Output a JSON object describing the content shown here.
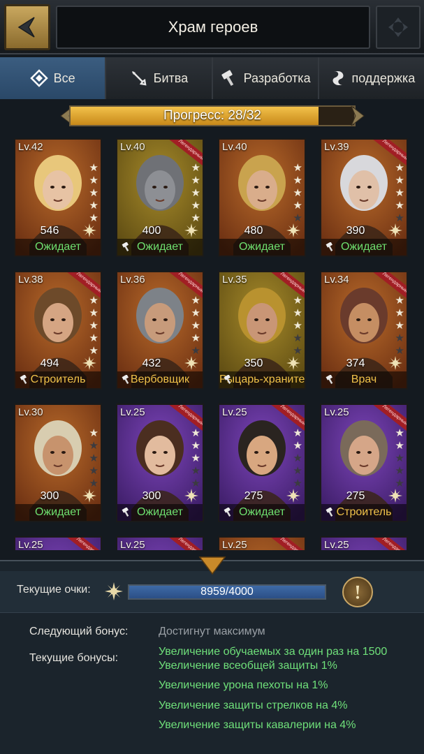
{
  "header": {
    "title": "Храм героев"
  },
  "tabs": [
    {
      "label": "Все",
      "icon": "diamond-icon",
      "active": true
    },
    {
      "label": "Битва",
      "icon": "sword-icon",
      "active": false
    },
    {
      "label": "Разработка",
      "icon": "hammer-icon",
      "active": false
    },
    {
      "label": "поддержка",
      "icon": "scroll-icon",
      "active": false
    }
  ],
  "progress": {
    "label": "Прогресс: 28/32",
    "fraction": 0.875
  },
  "heroes": [
    {
      "level": "Lv.42",
      "power": "546",
      "status": "Ожидает",
      "status_color": "#6ee06f",
      "legendary": false,
      "stars": 5,
      "tool": false,
      "bg": [
        "#b86a2a",
        "#6b2f12"
      ],
      "skin": "#e7c3a4",
      "hair": "#e8c77b"
    },
    {
      "level": "Lv.40",
      "power": "400",
      "status": "Ожидает",
      "status_color": "#6ee06f",
      "legendary": true,
      "stars": 5,
      "tool": true,
      "bg": [
        "#a68a2a",
        "#5c4a12"
      ],
      "skin": "#8d8f94",
      "hair": "#6f7176"
    },
    {
      "level": "Lv.40",
      "power": "480",
      "status": "Ожидает",
      "status_color": "#6ee06f",
      "legendary": false,
      "stars": 4,
      "tool": false,
      "bg": [
        "#b86a2a",
        "#6b2f12"
      ],
      "skin": "#d9ad8b",
      "hair": "#c9a34e"
    },
    {
      "level": "Lv.39",
      "power": "390",
      "status": "Ожидает",
      "status_color": "#6ee06f",
      "legendary": true,
      "stars": 4,
      "tool": true,
      "bg": [
        "#b86a2a",
        "#6b2f12"
      ],
      "skin": "#e0c0a8",
      "hair": "#d8d8dc"
    },
    {
      "level": "Lv.38",
      "power": "494",
      "status": "Строитель",
      "status_color": "#f0c24a",
      "legendary": true,
      "stars": 5,
      "tool": true,
      "bg": [
        "#b86a2a",
        "#6b2f12"
      ],
      "skin": "#d5a583",
      "hair": "#6d4a2a"
    },
    {
      "level": "Lv.36",
      "power": "432",
      "status": "Вербовщик",
      "status_color": "#f0c24a",
      "legendary": true,
      "stars": 4,
      "tool": true,
      "bg": [
        "#b86a2a",
        "#6b2f12"
      ],
      "skin": "#c79b7b",
      "hair": "#7d8288"
    },
    {
      "level": "Lv.35",
      "power": "350",
      "status": "Рыцарь-хранитель",
      "status_color": "#f0c24a",
      "legendary": true,
      "stars": 3,
      "tool": true,
      "bg": [
        "#a68a2a",
        "#5c4a12"
      ],
      "skin": "#c99676",
      "hair": "#b9922f"
    },
    {
      "level": "Lv.34",
      "power": "374",
      "status": "Врач",
      "status_color": "#f0c24a",
      "legendary": true,
      "stars": 3,
      "tool": true,
      "bg": [
        "#b86a2a",
        "#6b2f12"
      ],
      "skin": "#c58e63",
      "hair": "#6a3b2c"
    },
    {
      "level": "Lv.30",
      "power": "300",
      "status": "Ожидает",
      "status_color": "#6ee06f",
      "legendary": false,
      "stars": 1,
      "tool": false,
      "bg": [
        "#b86a2a",
        "#6b2f12"
      ],
      "skin": "#c7936d",
      "hair": "#d8cdb0"
    },
    {
      "level": "Lv.25",
      "power": "300",
      "status": "Ожидает",
      "status_color": "#6ee06f",
      "legendary": true,
      "stars": 3,
      "tool": true,
      "bg": [
        "#7b44b8",
        "#3c1d66"
      ],
      "skin": "#e2bb9e",
      "hair": "#4b2e20"
    },
    {
      "level": "Lv.25",
      "power": "275",
      "status": "Ожидает",
      "status_color": "#6ee06f",
      "legendary": true,
      "stars": 2,
      "tool": true,
      "bg": [
        "#7b44b8",
        "#3c1d66"
      ],
      "skin": "#d8a780",
      "hair": "#2a2420"
    },
    {
      "level": "Lv.25",
      "power": "275",
      "status": "Строитель",
      "status_color": "#f0c24a",
      "legendary": true,
      "stars": 2,
      "tool": true,
      "bg": [
        "#7b44b8",
        "#3c1d66"
      ],
      "skin": "#d5a688",
      "hair": "#7a6a5a"
    },
    {
      "level": "Lv.25",
      "power": "",
      "status": "",
      "status_color": "#6ee06f",
      "legendary": true,
      "stars": 0,
      "tool": false,
      "bg": [
        "#7b44b8",
        "#3c1d66"
      ],
      "skin": "#d5a688",
      "hair": "#5a4a3a"
    },
    {
      "level": "Lv.25",
      "power": "",
      "status": "",
      "status_color": "#6ee06f",
      "legendary": true,
      "stars": 0,
      "tool": false,
      "bg": [
        "#7b44b8",
        "#3c1d66"
      ],
      "skin": "#d5a688",
      "hair": "#5a4a3a"
    },
    {
      "level": "Lv.25",
      "power": "",
      "status": "",
      "status_color": "#6ee06f",
      "legendary": true,
      "stars": 0,
      "tool": false,
      "bg": [
        "#b86a2a",
        "#6b2f12"
      ],
      "skin": "#d5a688",
      "hair": "#5a4a3a"
    },
    {
      "level": "Lv.25",
      "power": "",
      "status": "",
      "status_color": "#6ee06f",
      "legendary": true,
      "stars": 0,
      "tool": false,
      "bg": [
        "#7b44b8",
        "#3c1d66"
      ],
      "skin": "#d5a688",
      "hair": "#5a4a3a"
    }
  ],
  "legendary_label": "Легендарный",
  "points": {
    "label": "Текущие очки:",
    "value": "8959/4000",
    "fraction": 1.0
  },
  "bonus": {
    "next_label": "Следующий бонус:",
    "next_value": "Достигнут максимум",
    "current_label": "Текущие бонусы:",
    "items": [
      "Увеличение обучаемых за один раз на 1500",
      "Увеличение всеобщей защиты 1%",
      "Увеличение урона пехоты на 1%",
      "Увеличение защиты стрелков на 4%",
      "Увеличение защиты кавалерии на 4%"
    ]
  }
}
